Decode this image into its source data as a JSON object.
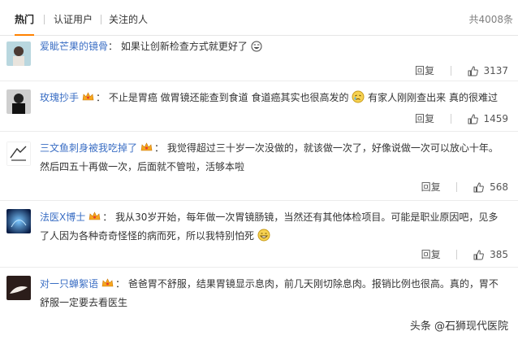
{
  "tabs": [
    {
      "label": "热门",
      "active": true
    },
    {
      "label": "认证用户",
      "active": false
    },
    {
      "label": "关注的人",
      "active": false
    }
  ],
  "total": "共4008条",
  "comments": [
    {
      "user": "爱眦芒果的镜骨",
      "text": "如果让创新检查方式就更好了",
      "reply": "回复",
      "likes": "3137"
    },
    {
      "user": "玫瑰抄手",
      "text": "不止是胃癌 做胃镜还能查到食道 食道癌其实也很高发的",
      "text2": "有家人刚刚查出来 真的很难过",
      "reply": "回复",
      "likes": "1459"
    },
    {
      "user": "三文鱼刺身被我吃掉了",
      "text": "我觉得超过三十岁一次没做的，就该做一次了，好像说做一次可以放心十年。然后四五十再做一次，后面就不管啦，活够本啦",
      "reply": "回复",
      "likes": "568"
    },
    {
      "user": "法医X博士",
      "text": "我从30岁开始，每年做一次胃镜肠镜，当然还有其他体检项目。可能是职业原因吧，见多了人因为各种奇奇怪怪的病而死，所以我特别怕死",
      "reply": "回复",
      "likes": "385"
    },
    {
      "user": "对一只蝉絮语",
      "text": "爸爸胃不舒服，结果胃镜显示息肉，前几天刚切除息肉。报销比例也很高。真的，胃不舒服一定要去看医生"
    }
  ],
  "watermark": "头条 @石狮现代医院",
  "colors": {
    "accent": "#ff8200",
    "username": "#eb7350",
    "link_blue": "#3a6ec4"
  }
}
